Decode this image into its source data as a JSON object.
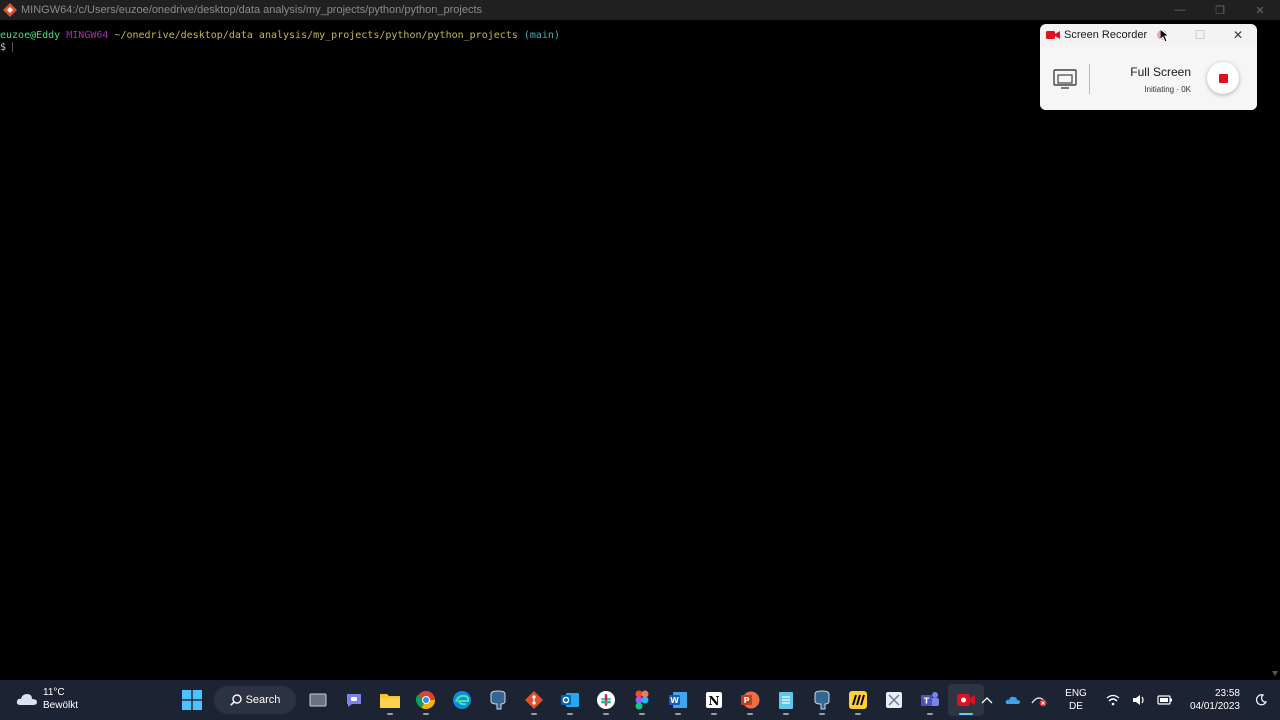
{
  "window": {
    "title": "MINGW64:/c/Users/euzoe/onedrive/desktop/data analysis/my_projects/python/python_projects"
  },
  "terminal": {
    "user_host": "euzoe@Eddy",
    "system": "MINGW64",
    "path": "~/onedrive/desktop/data analysis/my_projects/python/python_projects",
    "branch": "(main)",
    "prompt": "$"
  },
  "recorder": {
    "title": "Screen Recorder",
    "mode": "Full Screen",
    "status": "Initiating · 0K",
    "accent": "#e0101e"
  },
  "taskbar": {
    "weather_temp": "11°C",
    "weather_condition": "Bewölkt",
    "search_label": "Search",
    "apps": [
      "start-icon",
      "search",
      "task-view-icon",
      "teams-chat-icon",
      "file-explorer-icon",
      "chrome-icon",
      "edge-icon",
      "postgresql-icon",
      "git-icon",
      "outlook-icon",
      "slack-icon",
      "figma-icon",
      "word-icon",
      "notion-icon",
      "powerpoint-icon",
      "notepad-icon",
      "postgresql-icon",
      "miro-icon",
      "snipping-icon",
      "teams-icon",
      "screen-recorder-icon"
    ],
    "badges": {
      "chrome": "",
      "slack": "1"
    },
    "lang_top": "ENG",
    "lang_bottom": "DE",
    "time": "23:58",
    "date": "04/01/2023"
  }
}
